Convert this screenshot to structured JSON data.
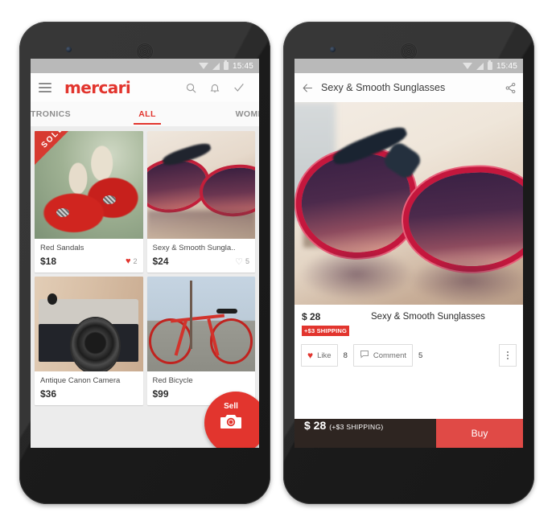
{
  "statusbar": {
    "time": "15:45",
    "icons": [
      "wifi-icon",
      "signal-icon",
      "battery-icon"
    ]
  },
  "colors": {
    "brand_red": "#e2352e",
    "buy_red": "#e04a46",
    "buybar_dark": "#2e2521",
    "feed_bg": "#ececec"
  },
  "left_phone": {
    "appbar": {
      "menu_icon": "hamburger-icon",
      "logo": "mercari",
      "search_icon": "search-icon",
      "notification_icon": "bell-icon",
      "check_icon": "check-icon"
    },
    "tabs": [
      {
        "label": "CTRONICS",
        "active": false
      },
      {
        "label": "ALL",
        "active": true
      },
      {
        "label": "WOMEN",
        "active": false
      }
    ],
    "cards": [
      {
        "title": "Red Sandals",
        "price": "$18",
        "likes": "2",
        "liked": true,
        "badge": "SOLD",
        "image": "red-sandals-photo"
      },
      {
        "title": "Sexy & Smooth Sungla..",
        "price": "$24",
        "likes": "5",
        "liked": false,
        "badge": "",
        "image": "red-sunglasses-photo"
      },
      {
        "title": "Antique Canon Camera",
        "price": "$36",
        "likes": "",
        "liked": false,
        "badge": "",
        "image": "canon-camera-photo"
      },
      {
        "title": "Red Bicycle",
        "price": "$99",
        "likes": "",
        "liked": false,
        "badge": "",
        "image": "red-bicycle-photo"
      }
    ],
    "fab": {
      "label": "Sell",
      "icon": "camera-icon"
    },
    "navbar": {
      "back": "back-triangle-icon",
      "home": "home-circle-icon",
      "recents": "recents-square-icon"
    }
  },
  "right_phone": {
    "detail_bar": {
      "back_icon": "arrow-left-icon",
      "title": "Sexy & Smooth Sunglasses",
      "share_icon": "share-icon"
    },
    "hero_image": "red-sunglasses-large-photo",
    "product": {
      "price": "$ 28",
      "shipping_badge": "+$3 SHIPPING",
      "name": "Sexy & Smooth Sunglasses"
    },
    "actions": {
      "like_label": "Like",
      "like_count": "8",
      "like_icon": "heart-filled-icon",
      "comment_label": "Comment",
      "comment_count": "5",
      "comment_icon": "comment-bubble-icon",
      "overflow_icon": "kebab-menu-icon"
    },
    "buybar": {
      "price": "$ 28",
      "shipping": "(+$3 SHIPPING)",
      "buy_label": "Buy"
    },
    "navbar": {
      "back": "back-triangle-icon",
      "home": "home-circle-icon",
      "recents": "recents-square-icon"
    }
  }
}
